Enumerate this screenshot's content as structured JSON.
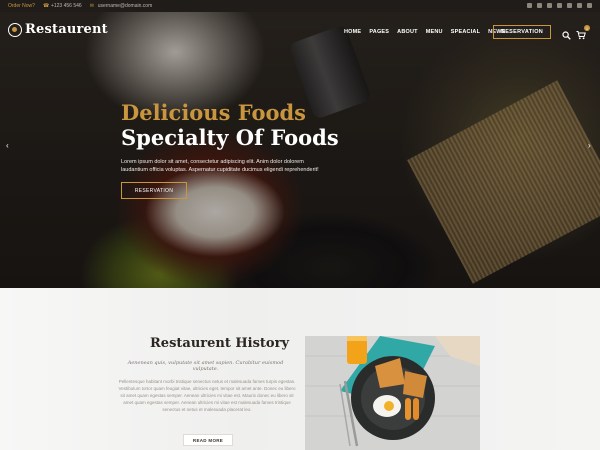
{
  "topbar": {
    "order_label": "Order Now?",
    "phone": "+123 456 546",
    "email": "username@domain.com"
  },
  "logo": {
    "text": "Restaurent"
  },
  "nav": {
    "items": [
      "HOME",
      "PAGES",
      "ABOUT",
      "MENU",
      "SPEACIAL",
      "NEWS"
    ],
    "reservation_label": "RESERVATION",
    "cart_count": "1"
  },
  "hero": {
    "title_line1": "Delicious Foods",
    "title_line2": "Specialty Of Foods",
    "description": "Lorem ipsum dolor sit amet, consectetur adipiscing elit. Anim dolor dolorem laudantium officia voluptas. Aspernatur cupiditate ducimus eligendi reprehenderit!",
    "button_label": "RESERVATION"
  },
  "history": {
    "title": "Restaurent History",
    "quote": "Aenenean quis, vulputate sit amet sapien. Curabitur euismod vulputate.",
    "body": "Pellentesque habitant morbi tristique senectus netus et malesuada fames turpis egestas. Vestibulum tortor quam feugiat vitae, ultricies eget, tempor sit amet ante. Donec eu libero sit amet quam egestas semper. Aenean ultricies mi vitae est. Mauris donec eu libero sit amet quam egestas semper. Aenean ultricies mi vitae est malesuada fames tristique senectus et netus et malesuada placerat leo.",
    "button_label": "READ MORE"
  },
  "colors": {
    "accent": "#c9963f",
    "dark": "#1f1c19"
  }
}
